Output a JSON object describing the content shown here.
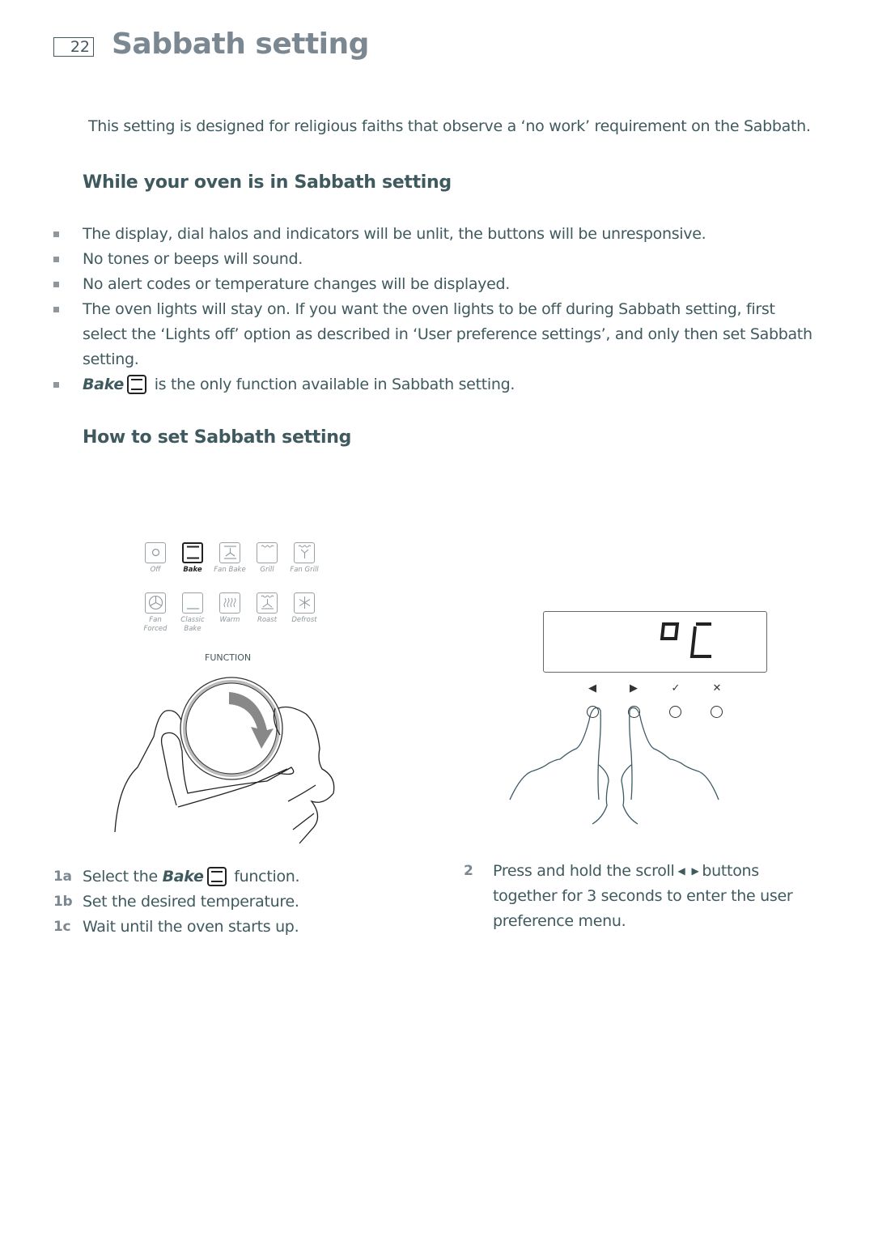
{
  "header": {
    "page_number": "22",
    "title": "Sabbath setting"
  },
  "intro": "This setting is designed for religious faiths that observe a ‘no work’ requirement on the Sabbath.",
  "section_while": {
    "heading": "While your oven is in Sabbath setting",
    "bullets": [
      "The display, dial halos and indicators will be unlit, the buttons will be unresponsive.",
      "No tones or beeps will sound.",
      "No alert codes or temperature changes will be displayed.",
      "The oven lights will stay on. If you want the oven lights to be off during Sabbath setting, first select the ‘Lights off’ option as described in ‘User preference settings’, and only then set Sabbath setting."
    ],
    "bake_bullet": {
      "bake": "Bake",
      "rest": "is the only function available in Sabbath setting.",
      "icon": "bake-icon"
    }
  },
  "section_how": {
    "heading": "How to set Sabbath setting"
  },
  "function_panel": {
    "label": "FUNCTION",
    "selected": "Bake",
    "functions_row1": [
      {
        "label": "Off",
        "icon": "off-icon"
      },
      {
        "label": "Bake",
        "icon": "bake-icon"
      },
      {
        "label": "Fan Bake",
        "icon": "fan-bake-icon"
      },
      {
        "label": "Grill",
        "icon": "grill-icon"
      },
      {
        "label": "Fan Grill",
        "icon": "fan-grill-icon"
      }
    ],
    "functions_row2": [
      {
        "label": "Fan Forced",
        "icon": "fan-forced-icon"
      },
      {
        "label": "Classic Bake",
        "icon": "classic-bake-icon"
      },
      {
        "label": "Warm",
        "icon": "warm-icon"
      },
      {
        "label": "Roast",
        "icon": "roast-icon"
      },
      {
        "label": "Defrost",
        "icon": "defrost-icon"
      }
    ]
  },
  "control_panel": {
    "display_text": "°C",
    "buttons": [
      {
        "symbol": "◀",
        "name": "scroll-left"
      },
      {
        "symbol": "▶",
        "name": "scroll-right"
      },
      {
        "symbol": "✓",
        "name": "confirm"
      },
      {
        "symbol": "✕",
        "name": "cancel"
      }
    ]
  },
  "steps_1": [
    {
      "num": "1a",
      "pre": "Select the",
      "bake": "Bake",
      "post": "function."
    },
    {
      "num": "1b",
      "text": "Set the desired temperature."
    },
    {
      "num": "1c",
      "text": "Wait until the oven starts up."
    }
  ],
  "step_2": {
    "num": "2",
    "line1_pre": "Press and hold the scroll",
    "left": "◀",
    "right": "▶",
    "line1_post": "buttons",
    "rest": "together for 3 seconds to enter the user preference menu."
  }
}
